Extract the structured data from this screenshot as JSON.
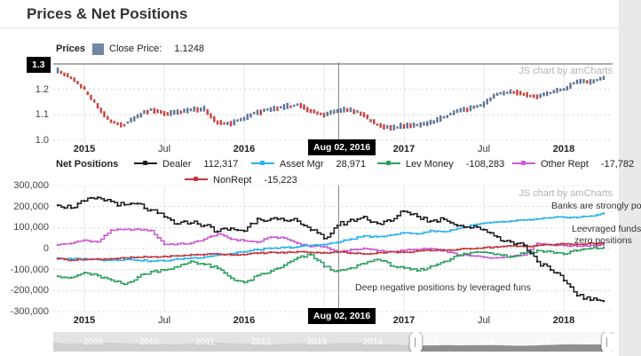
{
  "page": {
    "title": "Prices & Net Positions"
  },
  "price_chart": {
    "panel_label": "Prices",
    "legend": {
      "close_price_label": "Close Price:",
      "close_price_value": "1.1248",
      "swatch_color": "#7286a5"
    },
    "watermark": "JS chart by amCharts",
    "cursor_date": "Aug 02, 2016",
    "cursor_value": "1.3",
    "y_ticks": [
      {
        "label": "1.3",
        "v": 1.3
      },
      {
        "label": "1.2",
        "v": 1.2
      },
      {
        "label": "1.1",
        "v": 1.1
      },
      {
        "label": "1.0",
        "v": 1.0
      }
    ],
    "x_ticks": [
      {
        "label": "2015",
        "m": 2,
        "bold": true
      },
      {
        "label": "Jul",
        "m": 8,
        "bold": false
      },
      {
        "label": "2016",
        "m": 14,
        "bold": true
      },
      {
        "label": "2017",
        "m": 26,
        "bold": true
      },
      {
        "label": "Jul",
        "m": 32,
        "bold": false
      },
      {
        "label": "2018",
        "m": 38,
        "bold": true
      }
    ]
  },
  "np_chart": {
    "panel_label": "Net Positions",
    "watermark": "JS chart by amCharts",
    "cursor_date": "Aug 02, 2016",
    "legend": [
      {
        "name": "Dealer",
        "value": "112,317",
        "color": "#1c1c1c",
        "row": 1
      },
      {
        "name": "Asset Mgr",
        "value": "28,971",
        "color": "#27b2ef",
        "row": 1
      },
      {
        "name": "Lev Money",
        "value": "-108,283",
        "color": "#2aa05c",
        "row": 1
      },
      {
        "name": "Other Rept",
        "value": "-17,782",
        "color": "#cb5ad2",
        "row": 1
      },
      {
        "name": "NonRept",
        "value": "-15,223",
        "color": "#c3353d",
        "row": 2
      }
    ],
    "y_ticks": [
      {
        "label": "300,000",
        "v": 300
      },
      {
        "label": "200,000",
        "v": 200
      },
      {
        "label": "100,000",
        "v": 100
      },
      {
        "label": "0",
        "v": 0
      },
      {
        "label": "-100,000",
        "v": -100
      },
      {
        "label": "-200,000",
        "v": -200
      },
      {
        "label": "-300,000",
        "v": -300
      }
    ],
    "x_ticks": [
      {
        "label": "2015",
        "m": 2,
        "bold": true
      },
      {
        "label": "Jul",
        "m": 8,
        "bold": false
      },
      {
        "label": "2016",
        "m": 14,
        "bold": true
      },
      {
        "label": "2017",
        "m": 26,
        "bold": true
      },
      {
        "label": "Jul",
        "m": 32,
        "bold": false
      },
      {
        "label": "2018",
        "m": 38,
        "bold": true
      }
    ],
    "annotations": [
      {
        "text": "Banks are strongly positive"
      },
      {
        "text": "Leevraged funds show"
      },
      {
        "text": "zero positions"
      },
      {
        "text": "Deep negative positions by leveraged funs"
      }
    ]
  },
  "scrollbar": {
    "years": [
      "2009",
      "2010",
      "2011",
      "2012",
      "2013",
      "2014",
      "2015",
      "2016",
      "2017",
      "2018"
    ]
  },
  "chart_data": [
    {
      "type": "candlestick",
      "title": "Prices (Close Price)",
      "x_unit": "month",
      "x_start": "2014-11",
      "x_end": "2018-04",
      "ylim": [
        1.0,
        1.3
      ],
      "up_color": "#5d7496",
      "down_color": "#c8433f",
      "monthly_close": [
        1.275,
        1.245,
        1.205,
        1.135,
        1.075,
        1.06,
        1.095,
        1.12,
        1.105,
        1.11,
        1.12,
        1.125,
        1.07,
        1.065,
        1.085,
        1.11,
        1.12,
        1.13,
        1.14,
        1.115,
        1.1,
        1.115,
        1.12,
        1.1,
        1.06,
        1.05,
        1.055,
        1.06,
        1.07,
        1.09,
        1.115,
        1.125,
        1.14,
        1.18,
        1.19,
        1.18,
        1.17,
        1.185,
        1.2,
        1.23,
        1.23,
        1.245
      ]
    },
    {
      "type": "line",
      "step": true,
      "title": "Net Positions",
      "x_unit": "month",
      "x_start": "2014-11",
      "x_end": "2018-04",
      "ylim_thousands": [
        -300,
        300
      ],
      "grid": true,
      "legend_position": "top",
      "series": [
        {
          "name": "Dealer",
          "color": "#1c1c1c",
          "values_thousands": [
            210,
            195,
            225,
            240,
            225,
            205,
            212,
            180,
            150,
            115,
            125,
            112,
            82,
            95,
            85,
            145,
            140,
            130,
            135,
            90,
            45,
            112,
            135,
            150,
            120,
            130,
            180,
            155,
            130,
            142,
            112,
            100,
            92,
            55,
            30,
            18,
            -60,
            -105,
            -150,
            -220,
            -245,
            -250
          ]
        },
        {
          "name": "Asset Mgr",
          "color": "#27b2ef",
          "values_thousands": [
            -45,
            -50,
            -48,
            -52,
            -55,
            -52,
            -55,
            -60,
            -58,
            -50,
            -45,
            -40,
            -30,
            -25,
            -15,
            -5,
            0,
            5,
            8,
            15,
            20,
            29,
            45,
            60,
            55,
            65,
            75,
            70,
            85,
            80,
            95,
            110,
            120,
            125,
            130,
            135,
            140,
            145,
            150,
            148,
            155,
            168
          ]
        },
        {
          "name": "Lev Money",
          "color": "#2aa05c",
          "values_thousands": [
            -130,
            -140,
            -115,
            -130,
            -152,
            -170,
            -135,
            -110,
            -100,
            -88,
            -60,
            -75,
            -95,
            -140,
            -163,
            -130,
            -108,
            -80,
            -45,
            -30,
            -85,
            -108,
            -95,
            -70,
            -50,
            -80,
            -95,
            -105,
            -85,
            -60,
            -35,
            -20,
            -15,
            -25,
            -40,
            -20,
            -10,
            -15,
            -25,
            -10,
            0,
            5
          ]
        },
        {
          "name": "Other Rept",
          "color": "#cb5ad2",
          "values_thousands": [
            18,
            25,
            40,
            32,
            88,
            90,
            92,
            85,
            20,
            22,
            25,
            45,
            70,
            45,
            38,
            30,
            55,
            50,
            25,
            10,
            10,
            -18,
            -5,
            0,
            -10,
            -15,
            -8,
            -5,
            0,
            -10,
            -30,
            -35,
            -40,
            -45,
            -35,
            -30,
            25,
            18,
            15,
            12,
            15,
            18
          ]
        },
        {
          "name": "NonRept",
          "color": "#c3353d",
          "values_thousands": [
            -48,
            -55,
            -52,
            -50,
            -48,
            -45,
            -42,
            -40,
            -38,
            -35,
            -30,
            -28,
            -25,
            -30,
            -28,
            -22,
            -18,
            -20,
            -15,
            -18,
            -20,
            -15,
            -22,
            -25,
            -20,
            -15,
            -18,
            -12,
            -10,
            -8,
            -5,
            0,
            5,
            8,
            12,
            10,
            15,
            18,
            22,
            20,
            25,
            25
          ]
        }
      ]
    },
    {
      "type": "area",
      "role": "scrollbar-preview",
      "x_start": "2008-10",
      "x_end": "2018-04",
      "selected_range": [
        "2014-11",
        "2018-04"
      ],
      "values": [
        1.47,
        1.28,
        1.33,
        1.4,
        1.43,
        1.36,
        1.3,
        1.33,
        1.27,
        1.22,
        1.31,
        1.4,
        1.42,
        1.33,
        1.3,
        1.26,
        1.23,
        1.29,
        1.31,
        1.3,
        1.33,
        1.36,
        1.38,
        1.35,
        1.28,
        1.21,
        1.13,
        1.08,
        1.1,
        1.12,
        1.1,
        1.11,
        1.12,
        1.1,
        1.05,
        1.07,
        1.13,
        1.18,
        1.21,
        1.19,
        1.23,
        1.25
      ]
    }
  ]
}
